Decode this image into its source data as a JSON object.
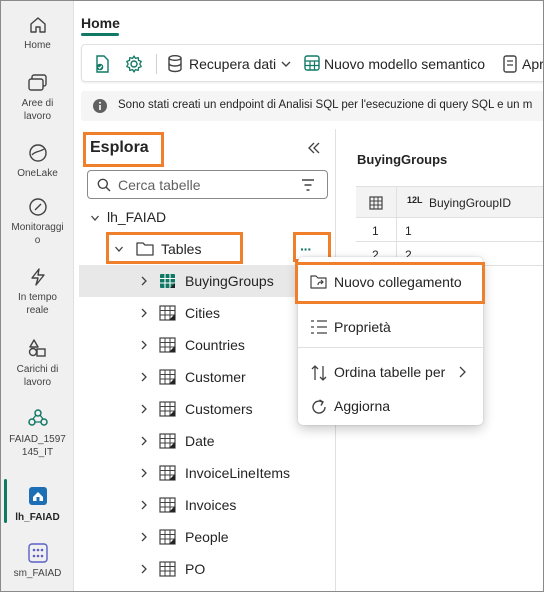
{
  "header": {
    "tab": "Home"
  },
  "toolbar": {
    "get_data_label": "Recupera dati",
    "new_model_label": "Nuovo modello semantico",
    "open_label": "Apr"
  },
  "info_bar": {
    "text": "Sono stati creati un endpoint di Analisi SQL per l'esecuzione di query SQL e un m"
  },
  "rail": {
    "items": [
      {
        "label": "Home",
        "icon": "home-icon"
      },
      {
        "label": "Aree di\nlavoro",
        "icon": "workspaces-icon"
      },
      {
        "label": "OneLake",
        "icon": "onelake-icon"
      },
      {
        "label": "Monitoraggi\no",
        "icon": "monitor-icon"
      },
      {
        "label": "In tempo\nreale",
        "icon": "realtime-icon"
      },
      {
        "label": "Carichi di\nlavoro",
        "icon": "workloads-icon"
      },
      {
        "label": "FAIAD_1597\n145_IT",
        "icon": "workspace-icon"
      },
      {
        "label": "lh_FAIAD",
        "icon": "lakehouse-icon"
      },
      {
        "label": "sm_FAIAD",
        "icon": "semantic-model-icon"
      }
    ]
  },
  "explorer": {
    "title": "Esplora",
    "search_placeholder": "Cerca tabelle",
    "root": "lh_FAIAD",
    "folder": "Tables",
    "more": "···",
    "tables": [
      "BuyingGroups",
      "Cities",
      "Countries",
      "Customer",
      "Customers",
      "Date",
      "InvoiceLineItems",
      "Invoices",
      "People",
      "PO"
    ]
  },
  "preview": {
    "title": "BuyingGroups",
    "column_type": "12L",
    "column": "BuyingGroupID",
    "rows": [
      {
        "index": "1",
        "value": "1"
      },
      {
        "index": "2",
        "value": "2"
      }
    ]
  },
  "context_menu": {
    "items": [
      {
        "label": "Nuovo collegamento",
        "icon": "new-shortcut-icon"
      },
      {
        "label": "Proprietà",
        "icon": "properties-icon"
      },
      {
        "label": "Ordina tabelle per",
        "icon": "sort-icon"
      },
      {
        "label": "Aggiorna",
        "icon": "refresh-icon"
      }
    ]
  },
  "colors": {
    "highlight": "#f07f2c",
    "accent": "#117865"
  }
}
